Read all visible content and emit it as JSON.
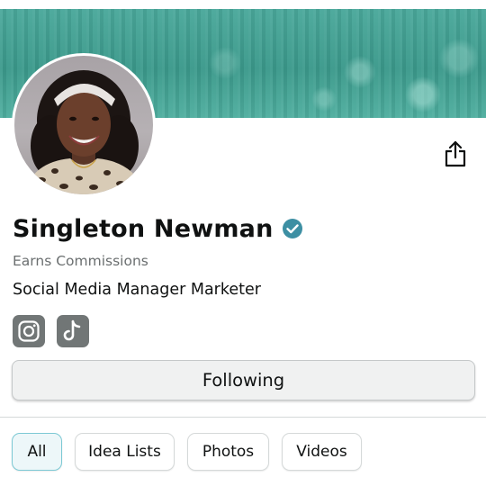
{
  "profile": {
    "name": "Singleton Newman",
    "verified": true,
    "earns_label": "Earns Commissions",
    "bio": "Social Media Manager Marketer"
  },
  "social_links": [
    {
      "icon": "instagram-icon"
    },
    {
      "icon": "tiktok-icon"
    }
  ],
  "actions": {
    "follow_label": "Following"
  },
  "tabs": [
    {
      "label": "All",
      "active": true
    },
    {
      "label": "Idea Lists",
      "active": false
    },
    {
      "label": "Photos",
      "active": false
    },
    {
      "label": "Videos",
      "active": false
    }
  ],
  "colors": {
    "banner": "#3b998b",
    "verified_badge": "#3d8fa3",
    "social_icon_bg": "#717676",
    "active_tab_bg": "#edf7f9",
    "active_tab_border": "#7cc9d4"
  }
}
